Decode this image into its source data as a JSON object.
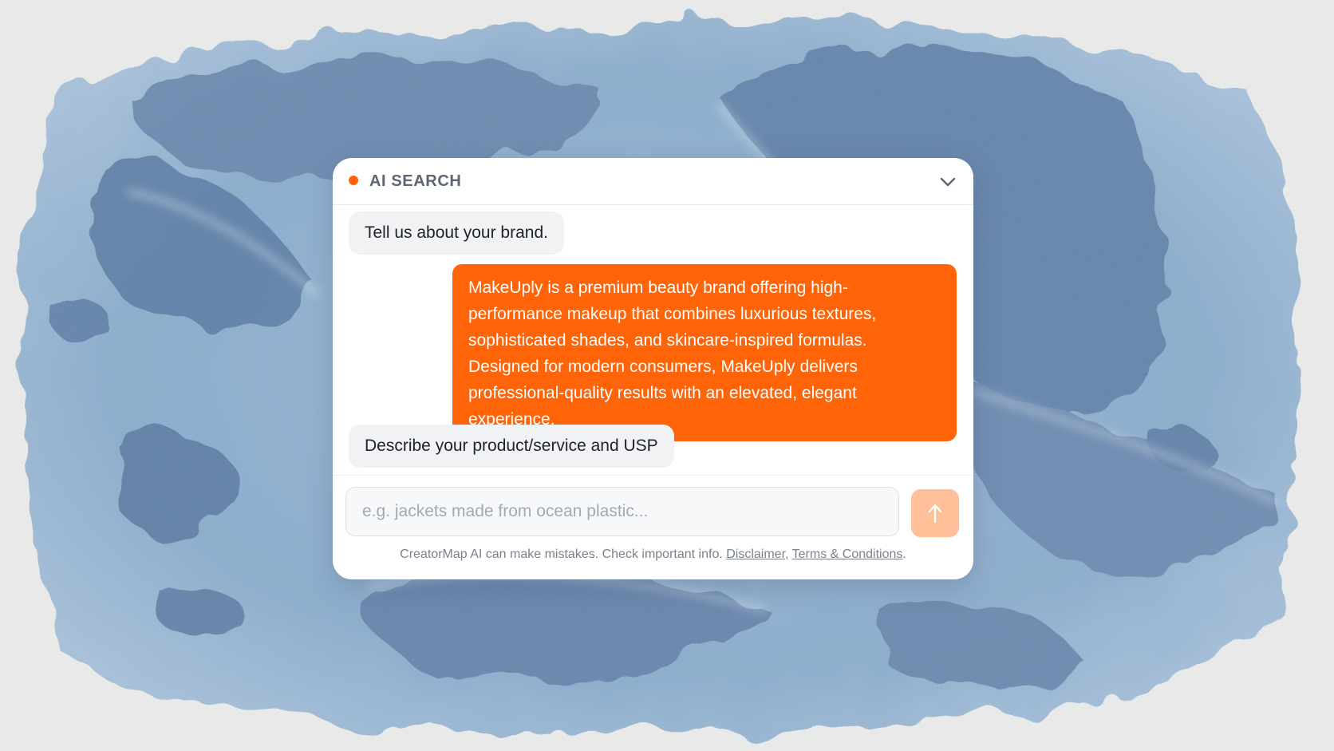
{
  "header": {
    "title": "AI SEARCH",
    "status_color": "#ff6508",
    "collapse_icon": "chevron-down-icon"
  },
  "messages": [
    {
      "role": "assistant",
      "text": "Tell us about your brand."
    },
    {
      "role": "user",
      "text": "MakeUply is a premium beauty brand offering high-performance makeup that combines luxurious textures, sophisticated shades, and skincare-inspired formulas. Designed for modern consumers, MakeUply delivers professional-quality results with an elevated, elegant experience."
    },
    {
      "role": "assistant",
      "text": "Describe your product/service and USP"
    }
  ],
  "composer": {
    "placeholder": "e.g. jackets made from ocean plastic...",
    "value": "",
    "send_icon": "arrow-up-icon",
    "send_color": "#ffbf99"
  },
  "footer": {
    "notice": "CreatorMap AI can make mistakes. Check important info.",
    "disclaimer_link": "Disclaimer",
    "separator": ",",
    "terms_link": "Terms & Conditions",
    "end": "."
  },
  "colors": {
    "accent": "#ff6408",
    "water": "#8fb1cf",
    "land": "#5f7fa5",
    "paper": "#f1f0ec"
  }
}
